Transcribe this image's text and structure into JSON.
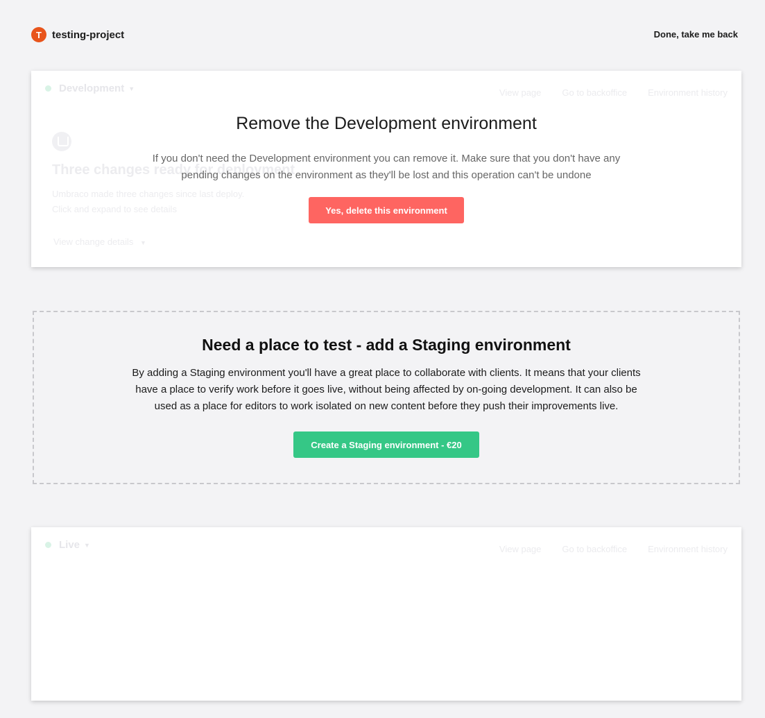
{
  "project": {
    "initial": "T",
    "name": "testing-project"
  },
  "back_link": "Done, take me back",
  "dev_card": {
    "env_name": "Development",
    "actions": [
      "View page",
      "Go to backoffice",
      "Environment history"
    ],
    "ghost_title": "Three changes ready for deployment",
    "ghost_sub": [
      "Umbraco made three changes since last deploy.",
      "Click and expand to see details"
    ],
    "ghost_details": "View change details",
    "overlay_title": "Remove the Development environment",
    "overlay_text": "If you don't need the Development environment you can remove it. Make sure that you don't have any pending changes on the environment as they'll be lost and this operation can't be undone",
    "delete_button": "Yes, delete this environment"
  },
  "staging": {
    "title": "Need a place to test - add a Staging environment",
    "text": "By adding a Staging environment you'll have a great place to collaborate with clients. It means that your clients have a place to verify work before it goes live, without being affected by on-going development. It can also be used as a place for editors to work isolated on new content before they push their improvements live.",
    "create_button": "Create a Staging environment - €20"
  },
  "live_card": {
    "env_name": "Live",
    "actions": [
      "View page",
      "Go to backoffice",
      "Environment history"
    ]
  },
  "colors": {
    "avatar": "#e8541b",
    "delete_button": "#fe6561",
    "create_button": "#35c786",
    "background": "#f3f3f5"
  }
}
